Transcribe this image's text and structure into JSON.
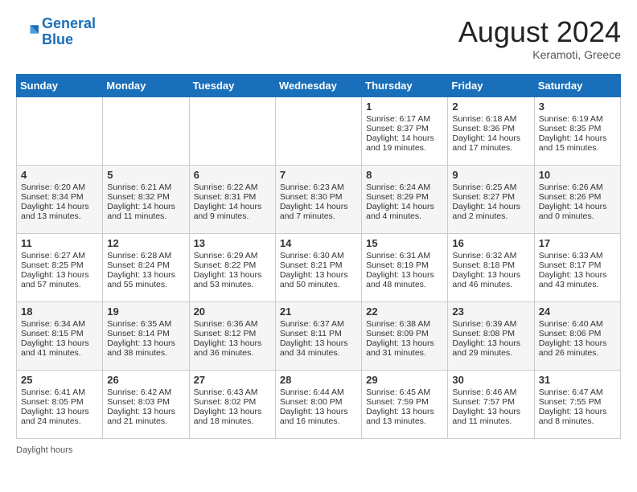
{
  "header": {
    "logo_line1": "General",
    "logo_line2": "Blue",
    "month_year": "August 2024",
    "location": "Keramoti, Greece"
  },
  "days_of_week": [
    "Sunday",
    "Monday",
    "Tuesday",
    "Wednesday",
    "Thursday",
    "Friday",
    "Saturday"
  ],
  "weeks": [
    [
      {
        "day": "",
        "info": ""
      },
      {
        "day": "",
        "info": ""
      },
      {
        "day": "",
        "info": ""
      },
      {
        "day": "",
        "info": ""
      },
      {
        "day": "1",
        "info": "Sunrise: 6:17 AM\nSunset: 8:37 PM\nDaylight: 14 hours and 19 minutes."
      },
      {
        "day": "2",
        "info": "Sunrise: 6:18 AM\nSunset: 8:36 PM\nDaylight: 14 hours and 17 minutes."
      },
      {
        "day": "3",
        "info": "Sunrise: 6:19 AM\nSunset: 8:35 PM\nDaylight: 14 hours and 15 minutes."
      }
    ],
    [
      {
        "day": "4",
        "info": "Sunrise: 6:20 AM\nSunset: 8:34 PM\nDaylight: 14 hours and 13 minutes."
      },
      {
        "day": "5",
        "info": "Sunrise: 6:21 AM\nSunset: 8:32 PM\nDaylight: 14 hours and 11 minutes."
      },
      {
        "day": "6",
        "info": "Sunrise: 6:22 AM\nSunset: 8:31 PM\nDaylight: 14 hours and 9 minutes."
      },
      {
        "day": "7",
        "info": "Sunrise: 6:23 AM\nSunset: 8:30 PM\nDaylight: 14 hours and 7 minutes."
      },
      {
        "day": "8",
        "info": "Sunrise: 6:24 AM\nSunset: 8:29 PM\nDaylight: 14 hours and 4 minutes."
      },
      {
        "day": "9",
        "info": "Sunrise: 6:25 AM\nSunset: 8:27 PM\nDaylight: 14 hours and 2 minutes."
      },
      {
        "day": "10",
        "info": "Sunrise: 6:26 AM\nSunset: 8:26 PM\nDaylight: 14 hours and 0 minutes."
      }
    ],
    [
      {
        "day": "11",
        "info": "Sunrise: 6:27 AM\nSunset: 8:25 PM\nDaylight: 13 hours and 57 minutes."
      },
      {
        "day": "12",
        "info": "Sunrise: 6:28 AM\nSunset: 8:24 PM\nDaylight: 13 hours and 55 minutes."
      },
      {
        "day": "13",
        "info": "Sunrise: 6:29 AM\nSunset: 8:22 PM\nDaylight: 13 hours and 53 minutes."
      },
      {
        "day": "14",
        "info": "Sunrise: 6:30 AM\nSunset: 8:21 PM\nDaylight: 13 hours and 50 minutes."
      },
      {
        "day": "15",
        "info": "Sunrise: 6:31 AM\nSunset: 8:19 PM\nDaylight: 13 hours and 48 minutes."
      },
      {
        "day": "16",
        "info": "Sunrise: 6:32 AM\nSunset: 8:18 PM\nDaylight: 13 hours and 46 minutes."
      },
      {
        "day": "17",
        "info": "Sunrise: 6:33 AM\nSunset: 8:17 PM\nDaylight: 13 hours and 43 minutes."
      }
    ],
    [
      {
        "day": "18",
        "info": "Sunrise: 6:34 AM\nSunset: 8:15 PM\nDaylight: 13 hours and 41 minutes."
      },
      {
        "day": "19",
        "info": "Sunrise: 6:35 AM\nSunset: 8:14 PM\nDaylight: 13 hours and 38 minutes."
      },
      {
        "day": "20",
        "info": "Sunrise: 6:36 AM\nSunset: 8:12 PM\nDaylight: 13 hours and 36 minutes."
      },
      {
        "day": "21",
        "info": "Sunrise: 6:37 AM\nSunset: 8:11 PM\nDaylight: 13 hours and 34 minutes."
      },
      {
        "day": "22",
        "info": "Sunrise: 6:38 AM\nSunset: 8:09 PM\nDaylight: 13 hours and 31 minutes."
      },
      {
        "day": "23",
        "info": "Sunrise: 6:39 AM\nSunset: 8:08 PM\nDaylight: 13 hours and 29 minutes."
      },
      {
        "day": "24",
        "info": "Sunrise: 6:40 AM\nSunset: 8:06 PM\nDaylight: 13 hours and 26 minutes."
      }
    ],
    [
      {
        "day": "25",
        "info": "Sunrise: 6:41 AM\nSunset: 8:05 PM\nDaylight: 13 hours and 24 minutes."
      },
      {
        "day": "26",
        "info": "Sunrise: 6:42 AM\nSunset: 8:03 PM\nDaylight: 13 hours and 21 minutes."
      },
      {
        "day": "27",
        "info": "Sunrise: 6:43 AM\nSunset: 8:02 PM\nDaylight: 13 hours and 18 minutes."
      },
      {
        "day": "28",
        "info": "Sunrise: 6:44 AM\nSunset: 8:00 PM\nDaylight: 13 hours and 16 minutes."
      },
      {
        "day": "29",
        "info": "Sunrise: 6:45 AM\nSunset: 7:59 PM\nDaylight: 13 hours and 13 minutes."
      },
      {
        "day": "30",
        "info": "Sunrise: 6:46 AM\nSunset: 7:57 PM\nDaylight: 13 hours and 11 minutes."
      },
      {
        "day": "31",
        "info": "Sunrise: 6:47 AM\nSunset: 7:55 PM\nDaylight: 13 hours and 8 minutes."
      }
    ]
  ],
  "footer": {
    "note": "Daylight hours"
  }
}
